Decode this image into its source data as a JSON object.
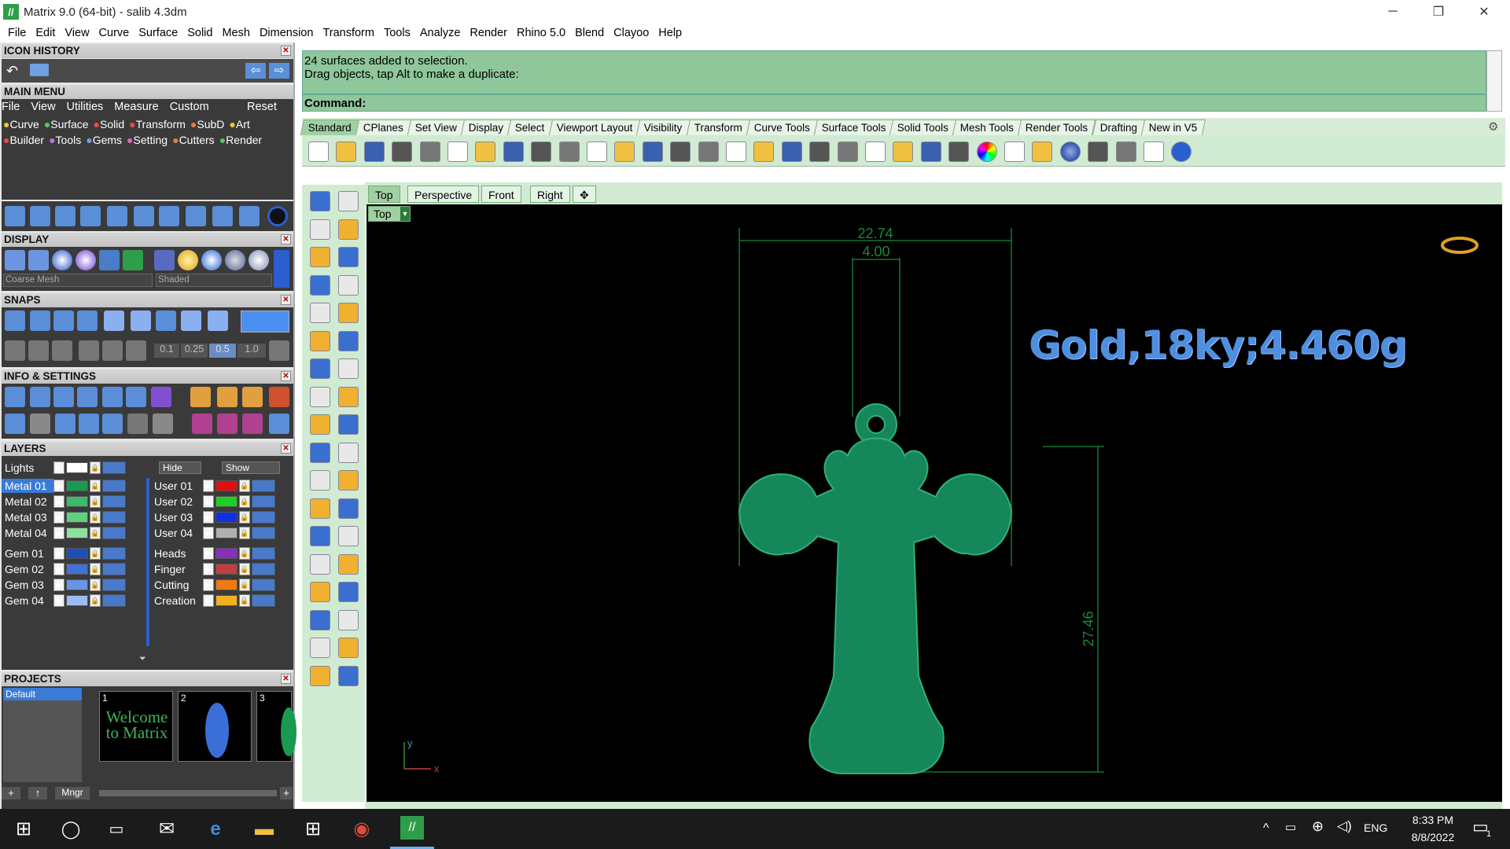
{
  "window": {
    "title": "Matrix 9.0 (64-bit) - salib 4.3dm",
    "app_icon": "matrix-logo",
    "minimize": "─",
    "restore": "❐",
    "close": "✕"
  },
  "menubar": [
    "File",
    "Edit",
    "View",
    "Curve",
    "Surface",
    "Solid",
    "Mesh",
    "Dimension",
    "Transform",
    "Tools",
    "Analyze",
    "Render",
    "Rhino 5.0",
    "Blend",
    "Clayoo",
    "Help"
  ],
  "panels": {
    "icon_history": "ICON HISTORY",
    "main_menu": "MAIN MENU",
    "display": "DISPLAY",
    "snaps": "SNAPS",
    "info_settings": "INFO & SETTINGS",
    "layers": "LAYERS",
    "projects": "PROJECTS"
  },
  "main_menu": {
    "items": [
      "File",
      "View",
      "Utilities",
      "Measure",
      "Custom"
    ],
    "reset": "Reset",
    "row1": [
      "Curve",
      "Surface",
      "Solid",
      "Transform",
      "SubD",
      "Art"
    ],
    "row2": [
      "Builder",
      "Tools",
      "Gems",
      "Setting",
      "Cutters",
      "Render"
    ]
  },
  "display": {
    "mesh_select": "Coarse Mesh",
    "shade_select": "Shaded"
  },
  "snaps": {
    "values": [
      "0.1",
      "0.25",
      "0.5",
      "1.0"
    ]
  },
  "layers": {
    "lights": "Lights",
    "hide": "Hide",
    "show": "Show",
    "left": [
      {
        "name": "Metal 01",
        "color": "#1a9a50",
        "selected": true
      },
      {
        "name": "Metal 02",
        "color": "#3cb96a"
      },
      {
        "name": "Metal 03",
        "color": "#5fd07f"
      },
      {
        "name": "Metal 04",
        "color": "#8ee09f"
      },
      {
        "name": "Gem 01",
        "color": "#1f4fb5"
      },
      {
        "name": "Gem 02",
        "color": "#3f72d4"
      },
      {
        "name": "Gem 03",
        "color": "#6a95e6"
      },
      {
        "name": "Gem 04",
        "color": "#9bbcf2"
      }
    ],
    "right": [
      {
        "name": "User 01",
        "color": "#e01010"
      },
      {
        "name": "User 02",
        "color": "#20d020"
      },
      {
        "name": "User 03",
        "color": "#1030e0"
      },
      {
        "name": "User 04",
        "color": "#b0b0b0"
      },
      {
        "name": "Heads",
        "color": "#8a2ec0"
      },
      {
        "name": "Finger",
        "color": "#c04040"
      },
      {
        "name": "Cutting",
        "color": "#f07a10"
      },
      {
        "name": "Creation",
        "color": "#f0b020"
      }
    ]
  },
  "projects": {
    "default": "Default",
    "thumbs": [
      "1",
      "2",
      "3"
    ],
    "welcome": "Welcome to Matrix",
    "mngr": "Mngr"
  },
  "command": {
    "line1": "24 surfaces added to selection.",
    "line2": "Drag objects, tap Alt to make a duplicate:",
    "prompt": "Command:"
  },
  "toolbar_tabs": [
    "Standard",
    "CPlanes",
    "Set View",
    "Display",
    "Select",
    "Viewport Layout",
    "Visibility",
    "Transform",
    "Curve Tools",
    "Surface Tools",
    "Solid Tools",
    "Mesh Tools",
    "Render Tools",
    "Drafting",
    "New in V5"
  ],
  "viewport_tabs": [
    "Top",
    "Perspective",
    "Front",
    "Right"
  ],
  "viewport": {
    "label": "Top",
    "annotation": "Gold,18ky;4.460g",
    "dim_width": "22.74",
    "dim_bail": "4.00",
    "dim_height": "27.46",
    "axis_y": "y",
    "axis_x": "x"
  },
  "taskbar": {
    "lang": "ENG",
    "time": "8:33 PM",
    "date": "8/8/2022",
    "notif_count": "1"
  }
}
